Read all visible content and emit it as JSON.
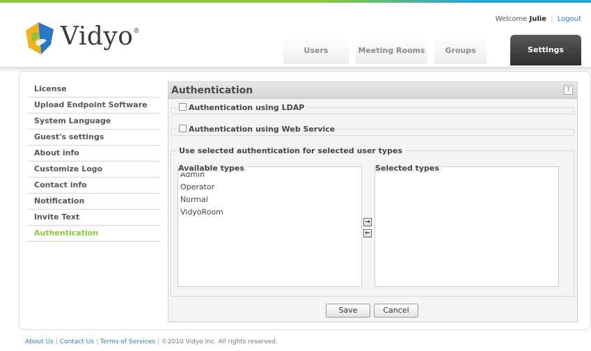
{
  "header": {
    "welcome_prefix": "Welcome",
    "user_name": "Julie",
    "logout": "Logout",
    "logo_text": "Vidyo",
    "logo_mark": "®"
  },
  "nav": {
    "tabs": [
      {
        "label": "Users"
      },
      {
        "label": "Meeting Rooms"
      },
      {
        "label": "Groups"
      },
      {
        "label": "Settings",
        "active": true
      }
    ]
  },
  "sidebar": {
    "items": [
      {
        "label": "License"
      },
      {
        "label": "Upload Endpoint Software"
      },
      {
        "label": "System Language"
      },
      {
        "label": "Guest's settings"
      },
      {
        "label": "About info"
      },
      {
        "label": "Customize Logo"
      },
      {
        "label": "Contact info"
      },
      {
        "label": "Notification"
      },
      {
        "label": "Invite Text"
      },
      {
        "label": "Authentication",
        "active": true
      }
    ]
  },
  "panel": {
    "title": "Authentication",
    "help": "?",
    "ldap_label": "Authentication using LDAP",
    "ldap_checked": false,
    "webservice_label": "Authentication using Web Service",
    "webservice_checked": false,
    "types_legend": "Use selected authentication for selected user types",
    "available_label": "Available types",
    "selected_label": "Selected types",
    "available_types": [
      "Admin",
      "Operator",
      "Normal",
      "VidyoRoom"
    ],
    "selected_types": [],
    "save": "Save",
    "cancel": "Cancel"
  },
  "footer": {
    "about": "About Us",
    "contact": "Contact Us",
    "terms": "Terms of Services",
    "copyright": "©2010 Vidyo Inc. All rights reserved."
  },
  "colors": {
    "accent_green": "#8cc63f",
    "accent_blue": "#2aa4d8",
    "link": "#2e7bbf",
    "active_tab": "#3a3a3a"
  }
}
